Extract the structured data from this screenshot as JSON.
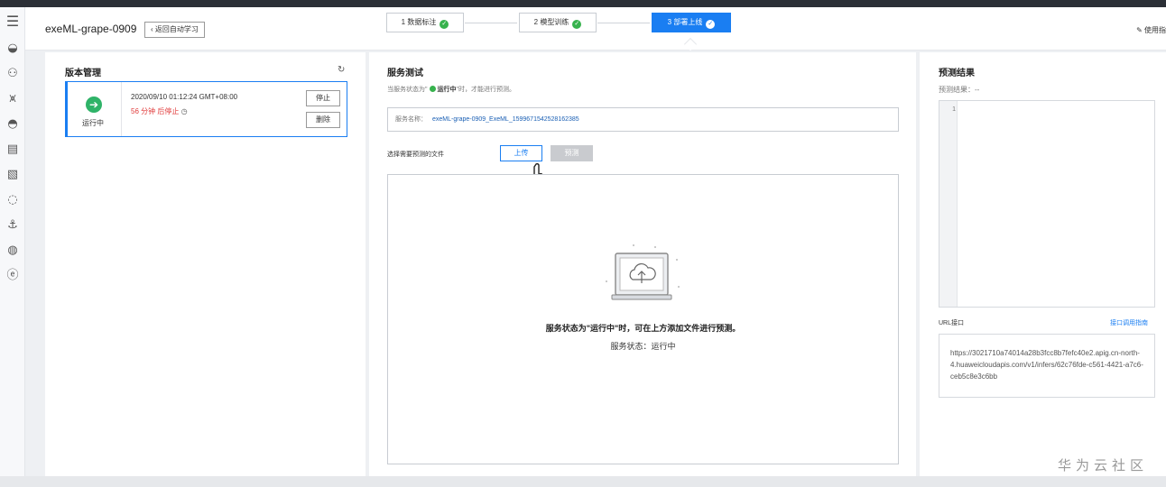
{
  "header": {
    "title": "exeML-grape-0909",
    "back_label": "返回自动学习",
    "help_label": "使用指"
  },
  "steps": [
    {
      "label": "1 数据标注",
      "done": true
    },
    {
      "label": "2 模型训练",
      "done": true
    },
    {
      "label": "3 部署上线",
      "done": true,
      "active": true
    }
  ],
  "version_panel": {
    "title": "版本管理",
    "card": {
      "status": "运行中",
      "time": "2020/09/10 01:12:24 GMT+08:00",
      "stop_note": "56 分钟 后停止",
      "stop_label": "停止",
      "delete_label": "删除"
    }
  },
  "service_test": {
    "title": "服务测试",
    "hint_prefix": "当服务状态为\"",
    "hint_status": "运行中",
    "hint_suffix": "\"时，才能进行预测。",
    "service_name_label": "服务名称：",
    "service_name_value": "exeML-grape-0909_ExeML_1599671542528162385",
    "file_label": "选择需要预测的文件",
    "upload_label": "上传",
    "predict_label": "预测",
    "drop_message": "服务状态为\"运行中\"时，可在上方添加文件进行预测。",
    "drop_status": "服务状态：运行中"
  },
  "result_panel": {
    "title": "预测结果",
    "result_label": "预测结果：--",
    "line_number": "1",
    "url_label": "URL接口",
    "api_link": "接口调用指南",
    "url_value": "https://3021710a74014a28b3fcc8b7fefc40e2.apig.cn-north-4.huaweicloudapis.com/v1/infers/62c76fde-c561-4421-a7c6-ceb5c8e3c6bb"
  },
  "watermark": "华为云社区",
  "colors": {
    "accent": "#1a7ef2",
    "success": "#37b24d",
    "danger": "#e03a3a"
  }
}
